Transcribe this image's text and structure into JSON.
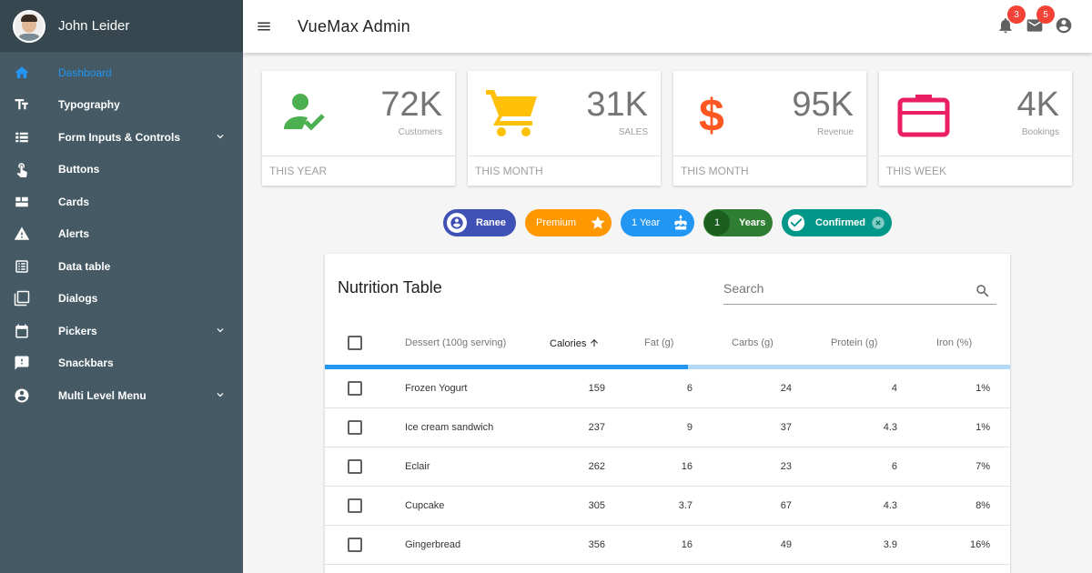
{
  "user": {
    "name": "John Leider"
  },
  "app": {
    "title": "VueMax Admin"
  },
  "sidebar": {
    "items": [
      {
        "label": "Dashboard",
        "icon": "home-icon",
        "active": true,
        "expandable": false
      },
      {
        "label": "Typography",
        "icon": "text-format-icon",
        "active": false,
        "expandable": false
      },
      {
        "label": "Form Inputs & Controls",
        "icon": "view-list-icon",
        "active": false,
        "expandable": true
      },
      {
        "label": "Buttons",
        "icon": "touch-icon",
        "active": false,
        "expandable": false
      },
      {
        "label": "Cards",
        "icon": "cards-icon",
        "active": false,
        "expandable": false
      },
      {
        "label": "Alerts",
        "icon": "warning-icon",
        "active": false,
        "expandable": false
      },
      {
        "label": "Data table",
        "icon": "table-icon",
        "active": false,
        "expandable": false
      },
      {
        "label": "Dialogs",
        "icon": "dialogs-icon",
        "active": false,
        "expandable": false
      },
      {
        "label": "Pickers",
        "icon": "calendar-icon",
        "active": false,
        "expandable": true
      },
      {
        "label": "Snackbars",
        "icon": "feedback-icon",
        "active": false,
        "expandable": false
      },
      {
        "label": "Multi Level Menu",
        "icon": "account-circle-icon",
        "active": false,
        "expandable": true
      }
    ]
  },
  "notifications": {
    "bell_count": "3",
    "mail_count": "5"
  },
  "colors": {
    "sidebar": "#455a64",
    "accent": "#2196f3",
    "green": "#4caf50",
    "yellow": "#ffc107",
    "orange": "#ff5722",
    "pink": "#e91e63"
  },
  "stats": [
    {
      "value": "72K",
      "label": "Customers",
      "period": "THIS YEAR",
      "icon": "person-check-icon"
    },
    {
      "value": "31K",
      "label": "SALES",
      "period": "THIS MONTH",
      "icon": "cart-icon"
    },
    {
      "value": "95K",
      "label": "Revenue",
      "period": "THIS MONTH",
      "icon": "dollar-icon"
    },
    {
      "value": "4K",
      "label": "Bookings",
      "period": "THIS WEEK",
      "icon": "briefcase-icon"
    }
  ],
  "chips": {
    "ranee": "Ranee",
    "premium": "Premium",
    "year": "1 Year",
    "years_count": "1",
    "years": "Years",
    "confirmed": "Confirmed"
  },
  "table": {
    "title": "Nutrition Table",
    "search_placeholder": "Search",
    "headers": [
      "Dessert (100g serving)",
      "Calories",
      "Fat (g)",
      "Carbs (g)",
      "Protein (g)",
      "Iron (%)"
    ],
    "loading_progress": 0.53,
    "rows": [
      {
        "name": "Frozen Yogurt",
        "calories": "159",
        "fat": "6",
        "carbs": "24",
        "protein": "4",
        "iron": "1%"
      },
      {
        "name": "Ice cream sandwich",
        "calories": "237",
        "fat": "9",
        "carbs": "37",
        "protein": "4.3",
        "iron": "1%"
      },
      {
        "name": "Eclair",
        "calories": "262",
        "fat": "16",
        "carbs": "23",
        "protein": "6",
        "iron": "7%"
      },
      {
        "name": "Cupcake",
        "calories": "305",
        "fat": "3.7",
        "carbs": "67",
        "protein": "4.3",
        "iron": "8%"
      },
      {
        "name": "Gingerbread",
        "calories": "356",
        "fat": "16",
        "carbs": "49",
        "protein": "3.9",
        "iron": "16%"
      }
    ]
  }
}
